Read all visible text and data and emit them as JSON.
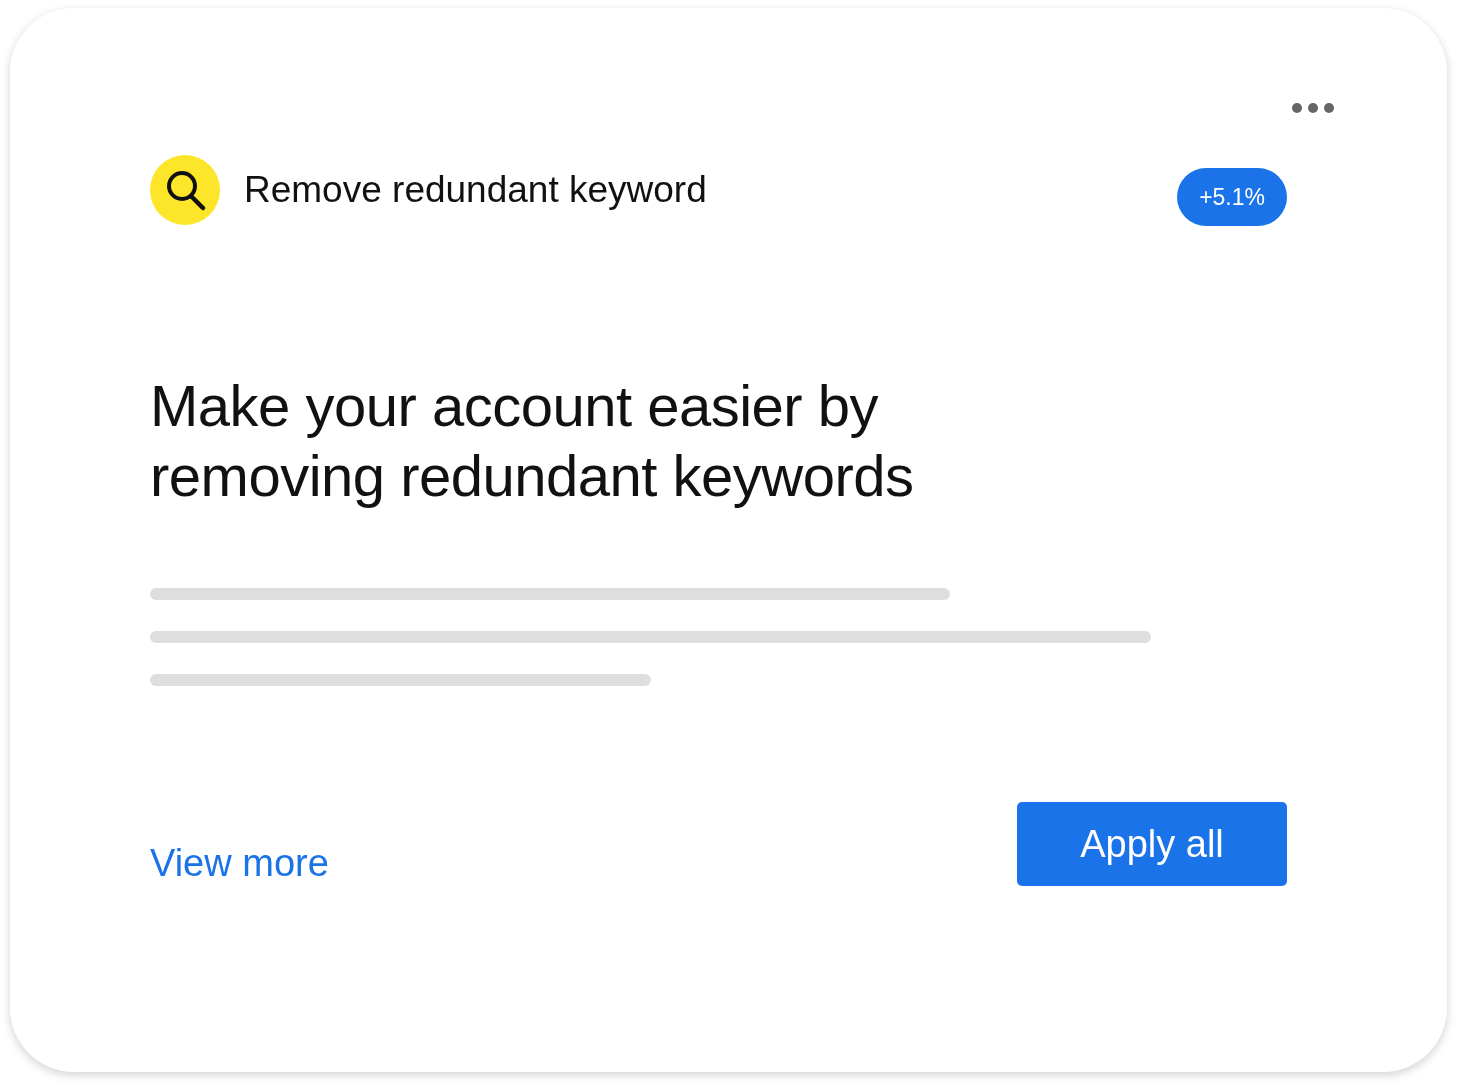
{
  "card": {
    "title": "Remove redundant keyword",
    "badge": "+5.1%",
    "headline_lines": [
      "Make your account easier by",
      "removing redundant keywords"
    ],
    "link": "View more",
    "button": "Apply all"
  }
}
